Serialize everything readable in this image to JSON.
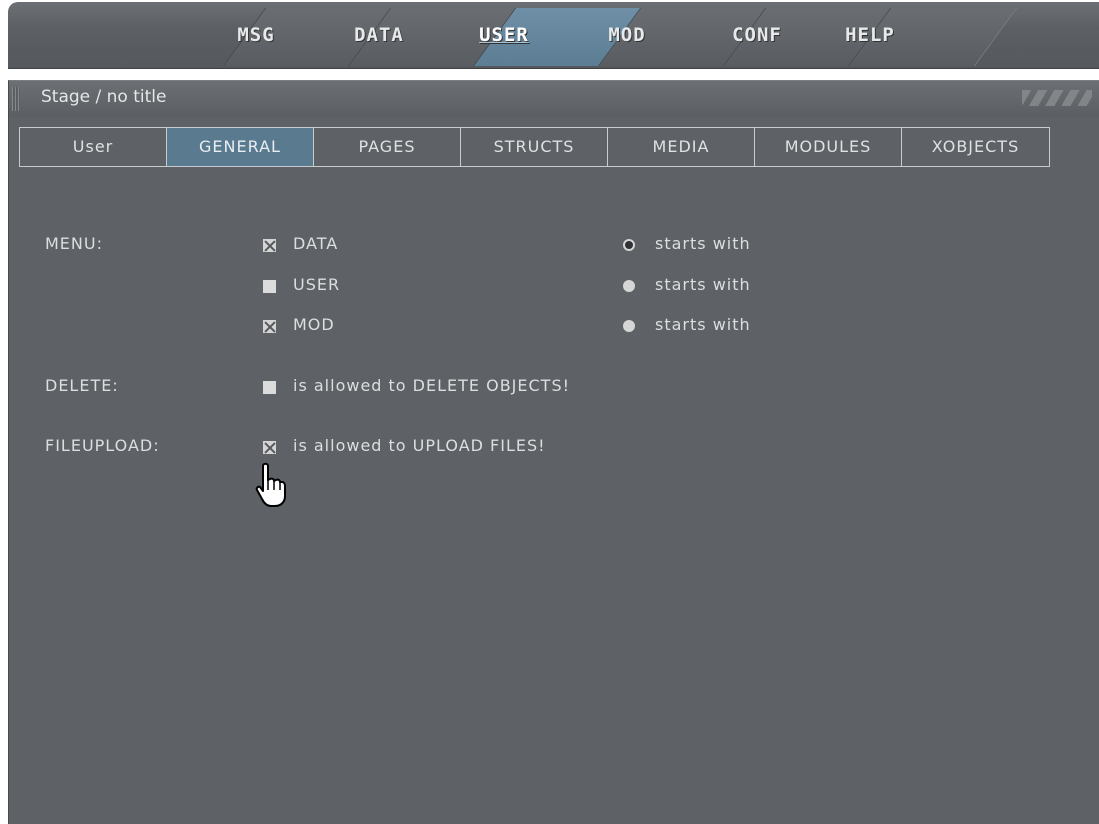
{
  "top_nav": {
    "tabs": [
      {
        "label": "MSG",
        "active": false
      },
      {
        "label": "DATA",
        "active": false
      },
      {
        "label": "USER",
        "active": true
      },
      {
        "label": "MOD",
        "active": false
      },
      {
        "label": "CONF",
        "active": false
      },
      {
        "label": "HELP",
        "active": false
      }
    ]
  },
  "stage": {
    "title": "Stage / no title"
  },
  "sub_tabs": [
    {
      "label": "User",
      "active": false
    },
    {
      "label": "GENERAL",
      "active": true
    },
    {
      "label": "PAGES",
      "active": false
    },
    {
      "label": "STRUCTS",
      "active": false
    },
    {
      "label": "MEDIA",
      "active": false
    },
    {
      "label": "MODULES",
      "active": false
    },
    {
      "label": "XOBJECTS",
      "active": false
    }
  ],
  "form": {
    "menu": {
      "label": "MENU:",
      "items": [
        {
          "label": "DATA",
          "checked": true,
          "radio_label": "starts with",
          "radio_selected": true
        },
        {
          "label": "USER",
          "checked": false,
          "radio_label": "starts with",
          "radio_selected": false
        },
        {
          "label": "MOD",
          "checked": true,
          "radio_label": "starts with",
          "radio_selected": false
        }
      ]
    },
    "delete": {
      "label": "DELETE:",
      "option_label": "is allowed to DELETE OBJECTS!",
      "checked": false
    },
    "fileupload": {
      "label": "FILEUPLOAD:",
      "option_label": "is allowed to UPLOAD FILES!",
      "checked": true
    }
  },
  "icons": {
    "cursor": "hand-pointer-icon"
  },
  "colors": {
    "accent": "#5a7a90",
    "panel": "#5e6165"
  }
}
